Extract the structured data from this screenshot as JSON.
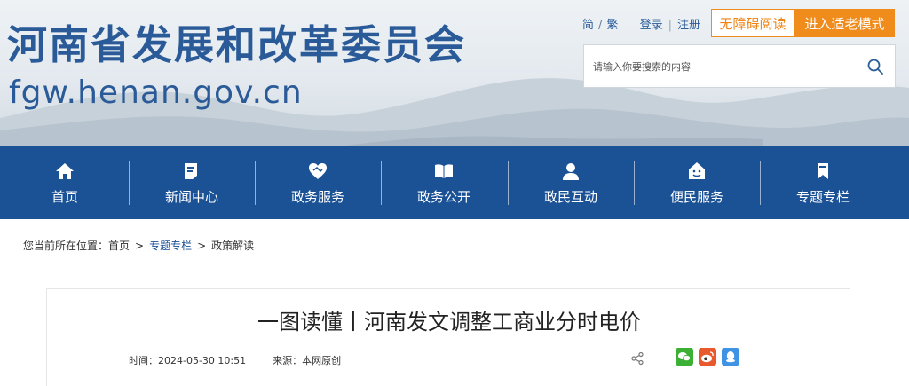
{
  "header": {
    "site_title": "河南省发展和改革委员会",
    "site_domain": "fgw.henan.gov.cn",
    "lang_simplified": "简",
    "lang_separator": "/",
    "lang_traditional": "繁",
    "login": "登录",
    "login_separator": "|",
    "register": "注册",
    "accessible_reading": "无障碍阅读",
    "elder_mode": "进入适老模式",
    "search_placeholder": "请输入你要搜索的内容"
  },
  "nav": {
    "items": [
      {
        "label": "首页",
        "icon": "home-icon"
      },
      {
        "label": "新闻中心",
        "icon": "news-icon"
      },
      {
        "label": "政务服务",
        "icon": "handshake-icon"
      },
      {
        "label": "政务公开",
        "icon": "book-icon"
      },
      {
        "label": "政民互动",
        "icon": "user-icon"
      },
      {
        "label": "便民服务",
        "icon": "smile-house-icon"
      },
      {
        "label": "专题专栏",
        "icon": "bookmark-icon"
      }
    ]
  },
  "breadcrumb": {
    "prefix": "您当前所在位置：",
    "items": [
      "首页",
      "专题专栏",
      "政策解读"
    ],
    "separator": ">"
  },
  "article": {
    "title": "一图读懂丨河南发文调整工商业分时电价",
    "time": "时间：2024-05-30 10:51",
    "source": "来源：本网原创"
  },
  "colors": {
    "brand_blue": "#1b5296",
    "title_blue": "#2a5b98",
    "accent_orange": "#f08c1c"
  }
}
